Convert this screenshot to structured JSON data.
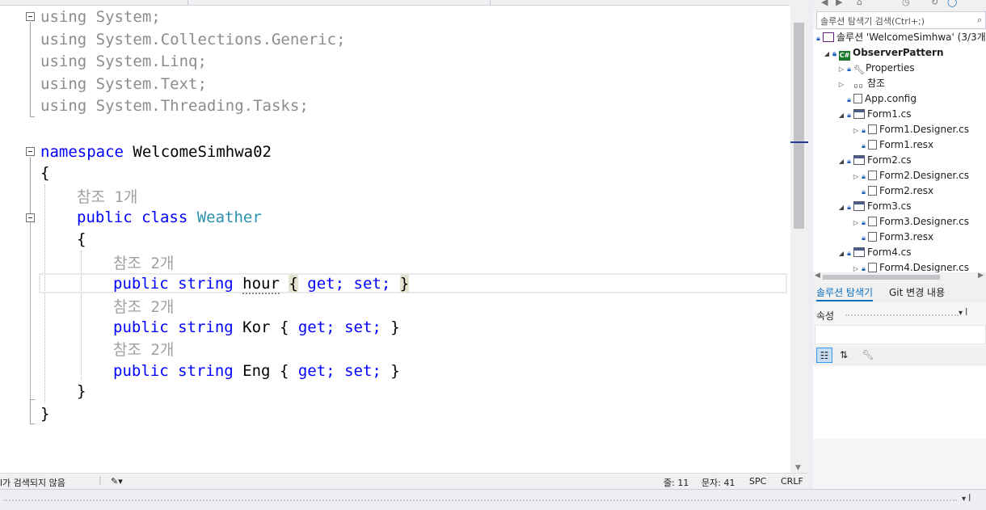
{
  "editor": {
    "usings": [
      {
        "kw": "using",
        "ns": "System;"
      },
      {
        "kw": "using",
        "ns": "System.Collections.Generic;"
      },
      {
        "kw": "using",
        "ns": "System.Linq;"
      },
      {
        "kw": "using",
        "ns": "System.Text;"
      },
      {
        "kw": "using",
        "ns": "System.Threading.Tasks;"
      }
    ],
    "namespace_kw": "namespace",
    "namespace_name": "WelcomeSimhwa02",
    "open_brace": "{",
    "close_brace": "}",
    "class_ref": "참조 1개",
    "class_kw": "public class",
    "class_name": "Weather",
    "members": [
      {
        "ref": "참조 2개",
        "modifier": "public string",
        "name": "hour",
        "open": "{",
        "get": "get;",
        "set": "set;",
        "close": "}"
      },
      {
        "ref": "참조 2개",
        "modifier": "public string",
        "name": "Kor",
        "open": "{",
        "get": "get;",
        "set": "set;",
        "close": "}"
      },
      {
        "ref": "참조 2개",
        "modifier": "public string",
        "name": "Eng",
        "open": "{",
        "get": "get;",
        "set": "set;",
        "close": "}"
      }
    ]
  },
  "statusbar": {
    "issues": "l가 검색되지 않음",
    "cleanup_icon": "✎▾",
    "line": "줄: 11",
    "column": "문자: 41",
    "indent": "SPC",
    "eol": "CRLF"
  },
  "solution_explorer": {
    "search_placeholder": "솔루션 탐색기 검색(Ctrl+;)",
    "items": [
      {
        "label": "솔루션 'WelcomeSimhwa' (3/3개",
        "icon": "solution-icon"
      },
      {
        "label": "ObserverPattern",
        "icon": "csharp-project-icon"
      },
      {
        "label": "Properties",
        "icon": "wrench-icon"
      },
      {
        "label": "참조",
        "icon": "references-icon"
      },
      {
        "label": "App.config",
        "icon": "file-icon"
      },
      {
        "label": "Form1.cs",
        "icon": "form-icon"
      },
      {
        "label": "Form1.Designer.cs",
        "icon": "file-icon"
      },
      {
        "label": "Form1.resx",
        "icon": "file-icon"
      },
      {
        "label": "Form2.cs",
        "icon": "form-icon"
      },
      {
        "label": "Form2.Designer.cs",
        "icon": "file-icon"
      },
      {
        "label": "Form2.resx",
        "icon": "file-icon"
      },
      {
        "label": "Form3.cs",
        "icon": "form-icon"
      },
      {
        "label": "Form3.Designer.cs",
        "icon": "file-icon"
      },
      {
        "label": "Form3.resx",
        "icon": "file-icon"
      },
      {
        "label": "Form4.cs",
        "icon": "form-icon"
      },
      {
        "label": "Form4.Designer.cs",
        "icon": "file-icon"
      }
    ],
    "tabs": [
      "솔루션 탐색기",
      "Git 변경 내용"
    ]
  },
  "properties": {
    "title": "속성",
    "pin_buttons": "▾ ꟾ"
  },
  "bottom_panel": {
    "pin_buttons": "▾ ꟾ"
  },
  "colors": {
    "keyword": "#0000ff",
    "type": "#2b91af",
    "comment_gray": "#8c8c8c",
    "accent": "#0e70c0"
  }
}
